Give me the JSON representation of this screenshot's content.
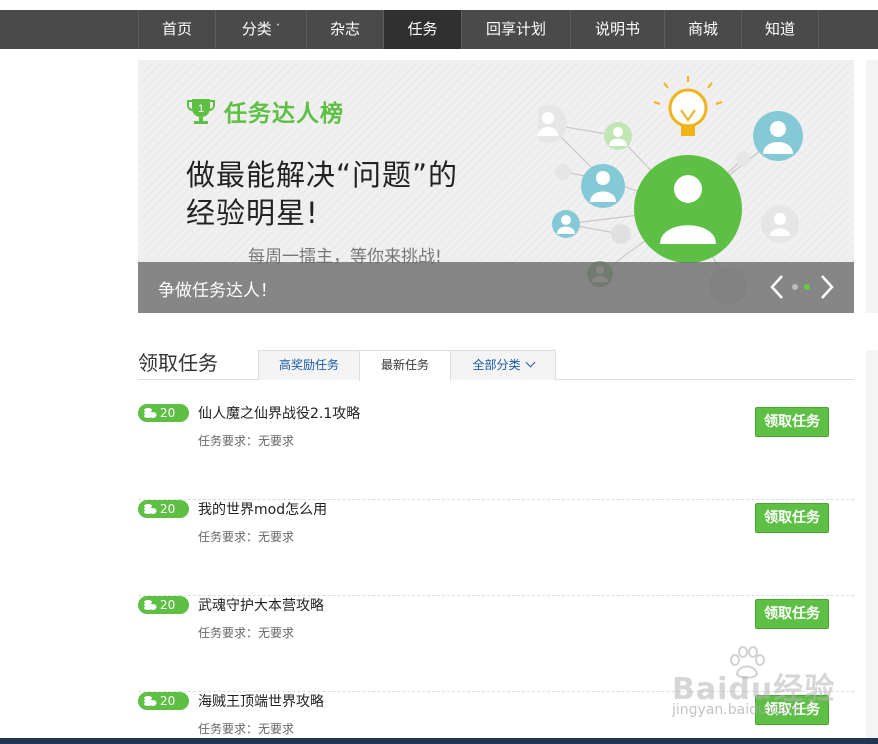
{
  "nav": {
    "items": [
      {
        "label": "首页",
        "active": false,
        "caret": false
      },
      {
        "label": "分类",
        "active": false,
        "caret": true
      },
      {
        "label": "杂志",
        "active": false,
        "caret": false
      },
      {
        "label": "任务",
        "active": true,
        "caret": false
      },
      {
        "label": "回享计划",
        "active": false,
        "caret": false
      },
      {
        "label": "说明书",
        "active": false,
        "caret": false
      },
      {
        "label": "商城",
        "active": false,
        "caret": false
      },
      {
        "label": "知道",
        "active": false,
        "caret": false
      }
    ]
  },
  "banner": {
    "badge_number": "1",
    "badge_title": "任务达人榜",
    "headline_line1": "做最能解决“问题”的",
    "headline_line2": "经验明星!",
    "subline": "每周一擂主，等你来挑战!",
    "caption": "争做任务达人！",
    "accent_color": "#5dbf43",
    "slide_count": 2,
    "active_slide": 2
  },
  "section": {
    "title": "领取任务",
    "tabs": [
      {
        "label": "高奖励任务",
        "active": false
      },
      {
        "label": "最新任务",
        "active": true
      },
      {
        "label": "全部分类",
        "active": false,
        "dropdown": true
      }
    ]
  },
  "tasks": [
    {
      "reward": "20",
      "title": "仙人魔之仙界战役2.1攻略",
      "requirement": "任务要求：无要求",
      "button": "领取任务"
    },
    {
      "reward": "20",
      "title": "我的世界mod怎么用",
      "requirement": "任务要求：无要求",
      "button": "领取任务"
    },
    {
      "reward": "20",
      "title": "武魂守护大本营攻略",
      "requirement": "任务要求：无要求",
      "button": "领取任务"
    },
    {
      "reward": "20",
      "title": "海贼王顶端世界攻略",
      "requirement": "任务要求：无要求",
      "button": "领取任务"
    }
  ],
  "watermark": {
    "brand": "Baidu经验",
    "domain": "jingyan.baidu.com"
  }
}
